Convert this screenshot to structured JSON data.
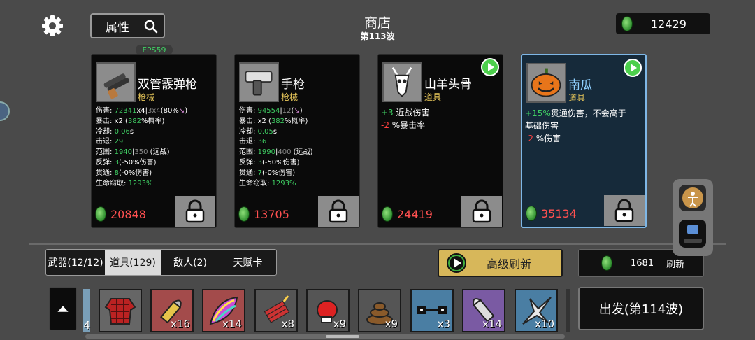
{
  "header": {
    "attr_label": "属性",
    "title": "商店",
    "wave": "第113波",
    "money": "12429",
    "fps": "FPS59"
  },
  "cards": [
    {
      "name": "双管霰弹枪",
      "category": "枪械",
      "price": "20848",
      "stats": [
        {
          "label": "伤害",
          "value": "72341",
          "extra": "x4",
          "gray": "3x4",
          "tail": "(80%"
        },
        {
          "label": "暴击",
          "value": "x2",
          "pct": "382",
          "tail": "%概率)"
        },
        {
          "label": "冷却",
          "value": "0.06",
          "unit": "s"
        },
        {
          "label": "击退",
          "value": "29"
        },
        {
          "label": "范围",
          "value": "1940",
          "gray": "350",
          "tail": "(远战)"
        },
        {
          "label": "反弹",
          "value": "3",
          "tail": "(-50%伤害)"
        },
        {
          "label": "贯通",
          "value": "8",
          "tail": "(-0%伤害)"
        },
        {
          "label": "生命窃取",
          "value": "1293%"
        }
      ]
    },
    {
      "name": "手枪",
      "category": "枪械",
      "price": "13705",
      "stats": [
        {
          "label": "伤害",
          "value": "94554",
          "gray": "12",
          "tail": "("
        },
        {
          "label": "暴击",
          "value": "x2",
          "pct": "382",
          "tail": "%概率)"
        },
        {
          "label": "冷却",
          "value": "0.05",
          "unit": "s"
        },
        {
          "label": "击退",
          "value": "36"
        },
        {
          "label": "范围",
          "value": "1990",
          "gray": "400",
          "tail": "(远战)"
        },
        {
          "label": "反弹",
          "value": "3",
          "tail": "(-50%伤害)"
        },
        {
          "label": "贯通",
          "value": "7",
          "tail": "(-0%伤害)"
        },
        {
          "label": "生命窃取",
          "value": "1293%"
        }
      ]
    },
    {
      "name": "山羊头骨",
      "category": "道具",
      "price": "24419",
      "effects": [
        {
          "value": "+3",
          "color": "green",
          "text": " 近战伤害"
        },
        {
          "value": "-2",
          "color": "red",
          "text": " %暴击率"
        }
      ]
    },
    {
      "name": "南瓜",
      "category": "道具",
      "price": "35134",
      "effects": [
        {
          "value": "+15%",
          "color": "green",
          "text": "贯通伤害，不会高于"
        },
        {
          "value": "",
          "color": "white",
          "text": "基础伤害"
        },
        {
          "value": "-2",
          "color": "red",
          "text": " %伤害"
        }
      ]
    }
  ],
  "tabs": [
    "武器(12/12)",
    "道具(129)",
    "敌人(2)",
    "天赋卡"
  ],
  "active_tab": 1,
  "buttons": {
    "advanced_refresh": "高级刷新",
    "refresh_cost": "1681",
    "refresh_label": "刷新",
    "go": "出发(第114波)"
  },
  "inventory": [
    {
      "count": "4",
      "icon": "partial-item-icon"
    },
    {
      "count": "",
      "icon": "plaid-shirt-icon"
    },
    {
      "count": "x16",
      "icon": "bullet-icon"
    },
    {
      "count": "x14",
      "icon": "rainbow-leaf-icon"
    },
    {
      "count": "x8",
      "icon": "dynamite-icon"
    },
    {
      "count": "x9",
      "icon": "boxing-glove-icon"
    },
    {
      "count": "x9",
      "icon": "poop-icon"
    },
    {
      "count": "x3",
      "icon": "dumbbell-icon"
    },
    {
      "count": "x14",
      "icon": "rocket-icon"
    },
    {
      "count": "x10",
      "icon": "shuriken-icon"
    }
  ],
  "colors": {
    "green": "#3fcf63",
    "red": "#ff4040",
    "gold_button": "#d7b75a",
    "selected_border": "#7fb7e6"
  }
}
